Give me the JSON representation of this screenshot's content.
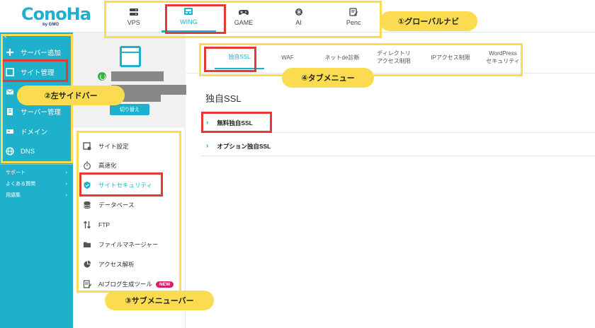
{
  "app": {
    "logo_text": "ConoHa",
    "logo_sub": "by GMO"
  },
  "global_nav": [
    {
      "label": "VPS",
      "icon": "server-icon"
    },
    {
      "label": "WING",
      "icon": "wing-icon",
      "active": true
    },
    {
      "label": "GAME",
      "icon": "gamepad-icon"
    },
    {
      "label": "AI",
      "icon": "ai-icon"
    },
    {
      "label": "Penc",
      "icon": "pencil-icon"
    }
  ],
  "sidebar": {
    "collapse_glyph": "‹",
    "items": [
      {
        "label": "サーバー追加",
        "icon": "plus-icon"
      },
      {
        "label": "サイト管理",
        "icon": "window-icon",
        "active": true
      },
      {
        "label": "",
        "icon": "mail-icon"
      },
      {
        "label": "サーバー管理",
        "icon": "server-manage-icon"
      },
      {
        "label": "ドメイン",
        "icon": "domain-icon"
      },
      {
        "label": "DNS",
        "icon": "globe-icon"
      }
    ],
    "links": [
      {
        "label": "サポート",
        "arrow": "›"
      },
      {
        "label": "よくある質問",
        "arrow": "›"
      },
      {
        "label": "用語集",
        "arrow": "›"
      }
    ]
  },
  "server_panel": {
    "switch_label": "切り替え"
  },
  "submenu": [
    {
      "label": "サイト設定",
      "icon": "site-settings-icon"
    },
    {
      "label": "高速化",
      "icon": "stopwatch-icon"
    },
    {
      "label": "サイトセキュリティ",
      "icon": "shield-icon",
      "active": true
    },
    {
      "label": "データベース",
      "icon": "database-icon"
    },
    {
      "label": "FTP",
      "icon": "transfer-icon"
    },
    {
      "label": "ファイルマネージャー",
      "icon": "folder-icon"
    },
    {
      "label": "アクセス解析",
      "icon": "pie-chart-icon"
    },
    {
      "label": "AIブログ生成ツール",
      "icon": "ai-blog-icon",
      "badge": "NEW"
    }
  ],
  "tabs": [
    {
      "label": "独自SSL",
      "active": true
    },
    {
      "label": "WAF"
    },
    {
      "label": "ネットde診断"
    },
    {
      "label": "ディレクトリ\nアクセス制限"
    },
    {
      "label": "IPアクセス制限"
    },
    {
      "label": "WordPress\nセキュリティ"
    }
  ],
  "main": {
    "title": "独自SSL",
    "rows": [
      {
        "label": "無料独自SSL",
        "chevron": "›"
      },
      {
        "label": "オプション独自SSL",
        "chevron": "›"
      }
    ]
  },
  "annotations": {
    "global_nav": "①グローバルナビ",
    "left_sidebar": "②左サイドバー",
    "sub_menu": "③サブメニューバー",
    "tab_menu": "④タブメニュー"
  },
  "colors": {
    "brand": "#1fb1cc",
    "highlight_red": "#e53935",
    "highlight_yellow": "#fbdc50",
    "badge": "#d6206d"
  }
}
